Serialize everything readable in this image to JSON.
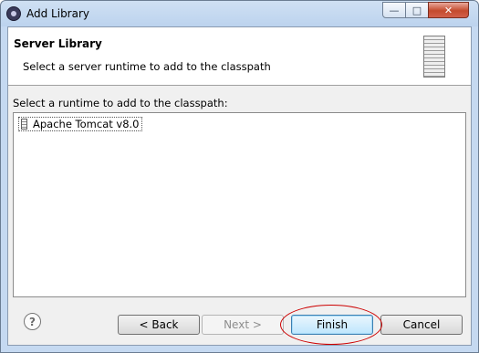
{
  "window": {
    "title": "Add Library",
    "controls": {
      "minimize": "—",
      "maximize": "□",
      "close": "✕"
    }
  },
  "header": {
    "title": "Server Library",
    "description": "Select a server runtime to add to the classpath"
  },
  "runtime_list": {
    "label": "Select a runtime to add to the classpath:",
    "items": [
      {
        "label": "Apache Tomcat v8.0",
        "selected": true
      }
    ]
  },
  "buttons": {
    "help": "?",
    "back": "< Back",
    "next": "Next >",
    "finish": "Finish",
    "cancel": "Cancel"
  },
  "icons": {
    "app": "eclipse-icon",
    "header": "server-icon",
    "item": "server-runtime-icon"
  },
  "colors": {
    "annotation_ellipse": "#cc0000",
    "default_button_border": "#3c7fb1"
  }
}
